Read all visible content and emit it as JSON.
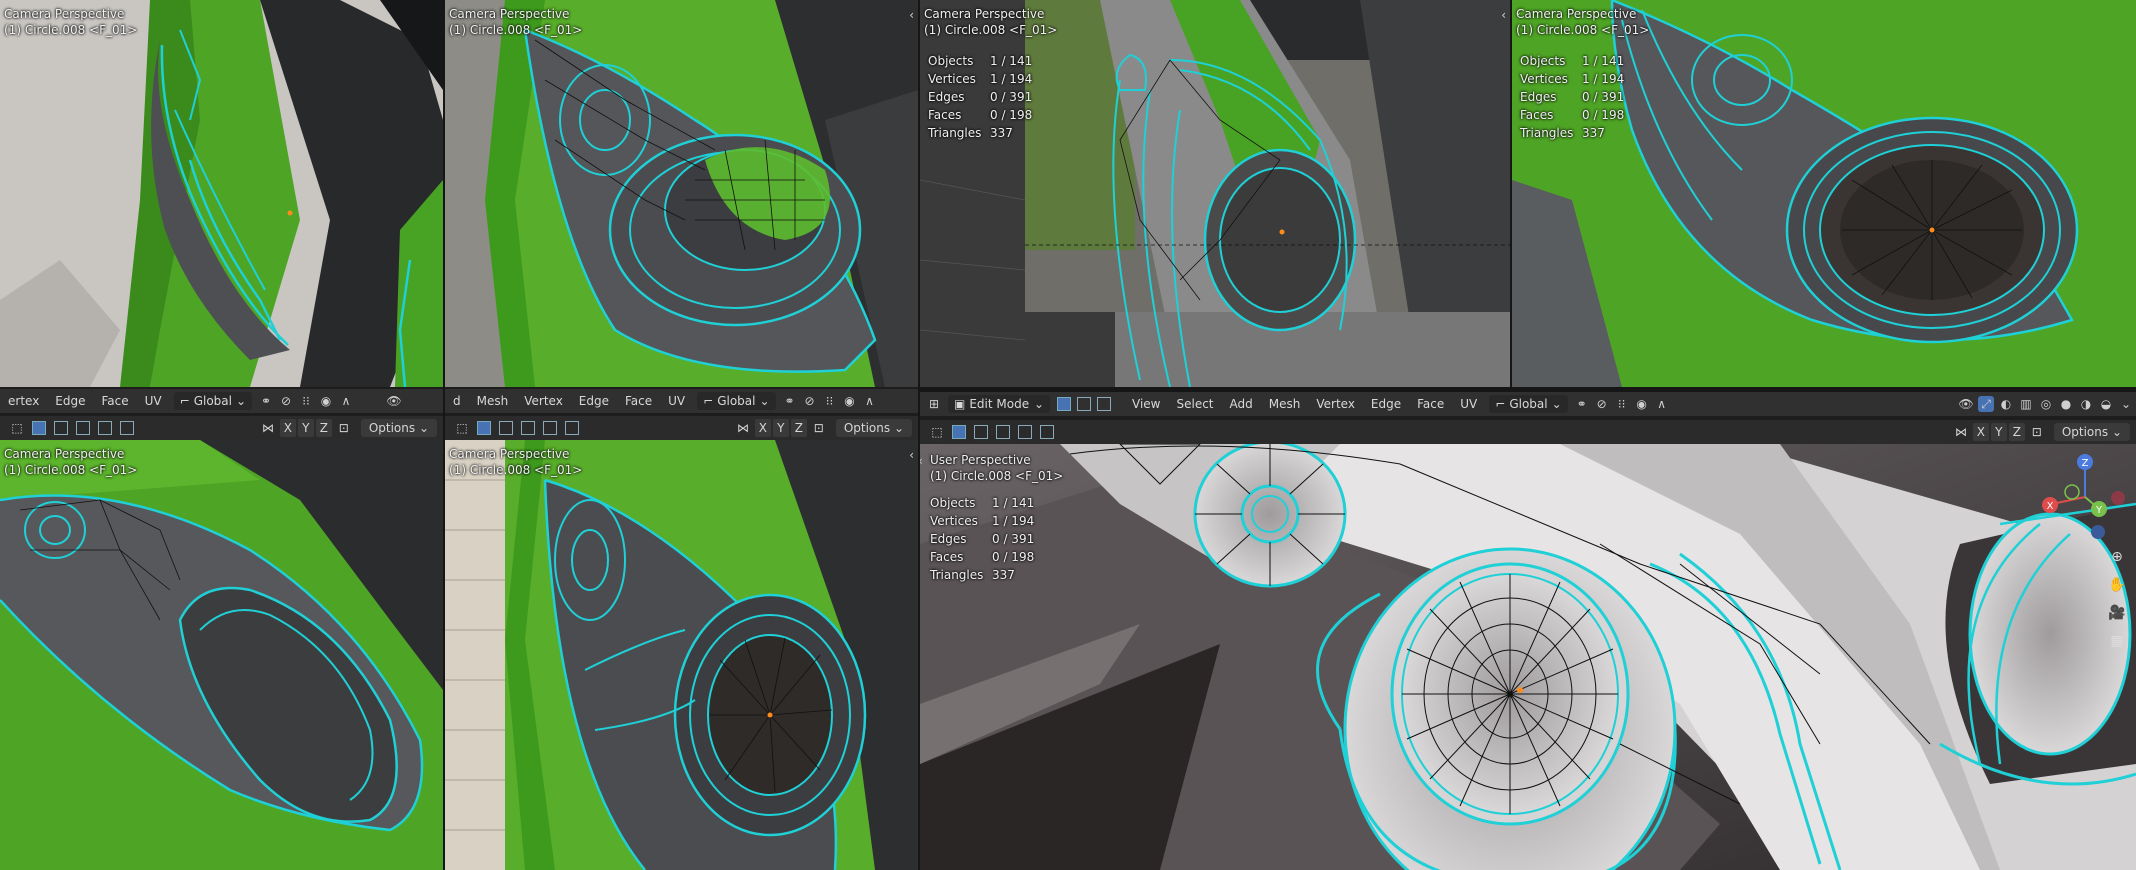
{
  "colors": {
    "mesh_edge": "#1fd0d6",
    "mesh_wire": "#111111",
    "vertex": "#0a0a0a",
    "active": "#ff8c1a",
    "green": "#3fae1f",
    "accent": "#4772b3"
  },
  "viewports": {
    "top1": {
      "title": "Camera Perspective",
      "object": "(1) Circle.008 <F_01>"
    },
    "top2": {
      "title": "Camera Perspective",
      "object": "(1) Circle.008 <F_01>"
    },
    "top3": {
      "title": "Camera Perspective",
      "object": "(1) Circle.008 <F_01>"
    },
    "top4": {
      "title": "Camera Perspective",
      "object": "(1) Circle.008 <F_01>"
    },
    "bot1": {
      "title": "Camera Perspective",
      "object": "(1) Circle.008 <F_01>"
    },
    "bot2": {
      "title": "Camera Perspective",
      "object": "(1) Circle.008 <F_01>"
    },
    "bot3": {
      "title": "User Perspective",
      "object": "(1) Circle.008 <F_01>"
    }
  },
  "stats": {
    "labels": {
      "objects": "Objects",
      "vertices": "Vertices",
      "edges": "Edges",
      "faces": "Faces",
      "triangles": "Triangles"
    },
    "values": {
      "objects": "1 / 141",
      "vertices": "1 / 194",
      "edges": "0 / 391",
      "faces": "0 / 198",
      "triangles": "337"
    }
  },
  "header_left": {
    "items": [
      "ertex",
      "Edge",
      "Face",
      "UV"
    ],
    "orientation": "Global"
  },
  "header_mid": {
    "items": [
      "d",
      "Mesh",
      "Vertex",
      "Edge",
      "Face",
      "UV"
    ],
    "orientation": "Global"
  },
  "header_main": {
    "mode": "Edit Mode",
    "items": [
      "View",
      "Select",
      "Add",
      "Mesh",
      "Vertex",
      "Edge",
      "Face",
      "UV"
    ],
    "orientation": "Global"
  },
  "toolbar": {
    "x": "X",
    "y": "Y",
    "z": "Z",
    "options": "Options"
  },
  "gizmo": {
    "x": "X",
    "y": "Y",
    "z": "Z"
  }
}
